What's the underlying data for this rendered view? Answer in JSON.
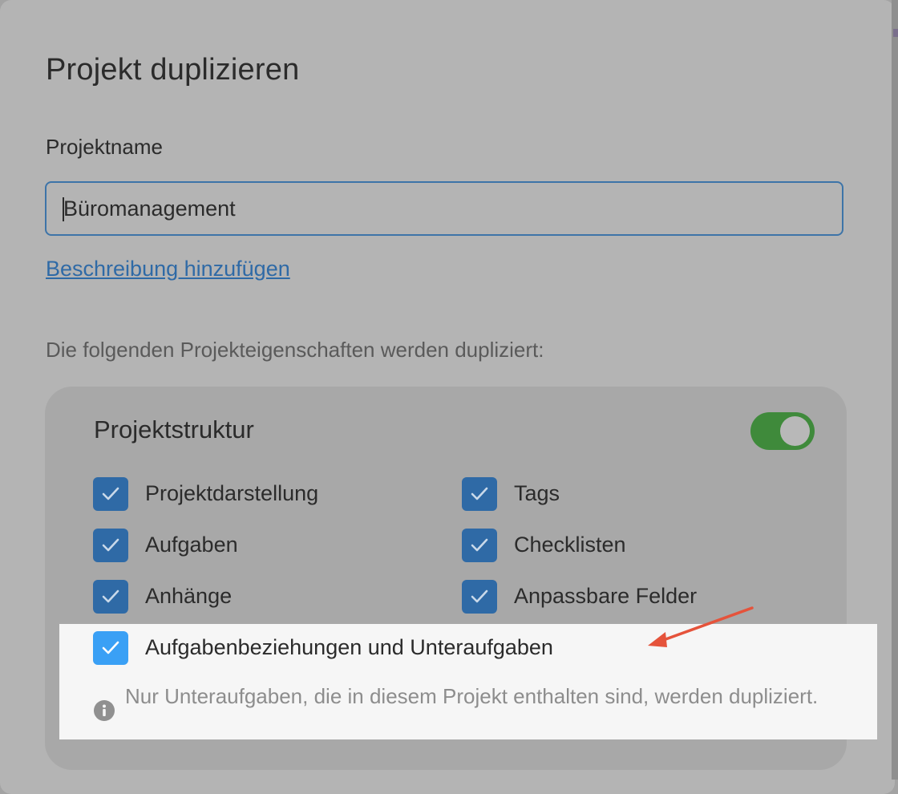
{
  "dialog": {
    "title": "Projekt duplizieren",
    "name_label": "Projektname",
    "name_value": "Büromanagement",
    "add_description_link": "Beschreibung hinzufügen",
    "properties_intro": "Die folgenden Projekteigenschaften werden dupliziert:"
  },
  "structure": {
    "title": "Projektstruktur",
    "toggle_on": true,
    "options": {
      "projektdarstellung": {
        "label": "Projektdarstellung",
        "checked": true
      },
      "tags": {
        "label": "Tags",
        "checked": true
      },
      "aufgaben": {
        "label": "Aufgaben",
        "checked": true
      },
      "checklisten": {
        "label": "Checklisten",
        "checked": true
      },
      "anhaenge": {
        "label": "Anhänge",
        "checked": true
      },
      "felder": {
        "label": "Anpassbare Felder",
        "checked": true
      },
      "beziehungen": {
        "label": "Aufgabenbeziehungen und Unteraufgaben",
        "checked": true
      }
    },
    "note": "Nur Unteraufgaben, die in diesem Projekt enthalten sind, werden dupliziert."
  },
  "colors": {
    "accent_blue": "#2f6aa6",
    "highlight_checkbox": "#3aa0f5",
    "toggle_green": "#3f8a3b",
    "arrow_red": "#e5533b"
  },
  "icons": {
    "checkbox": "check-icon",
    "note": "info-icon",
    "annotation": "arrow-icon"
  }
}
